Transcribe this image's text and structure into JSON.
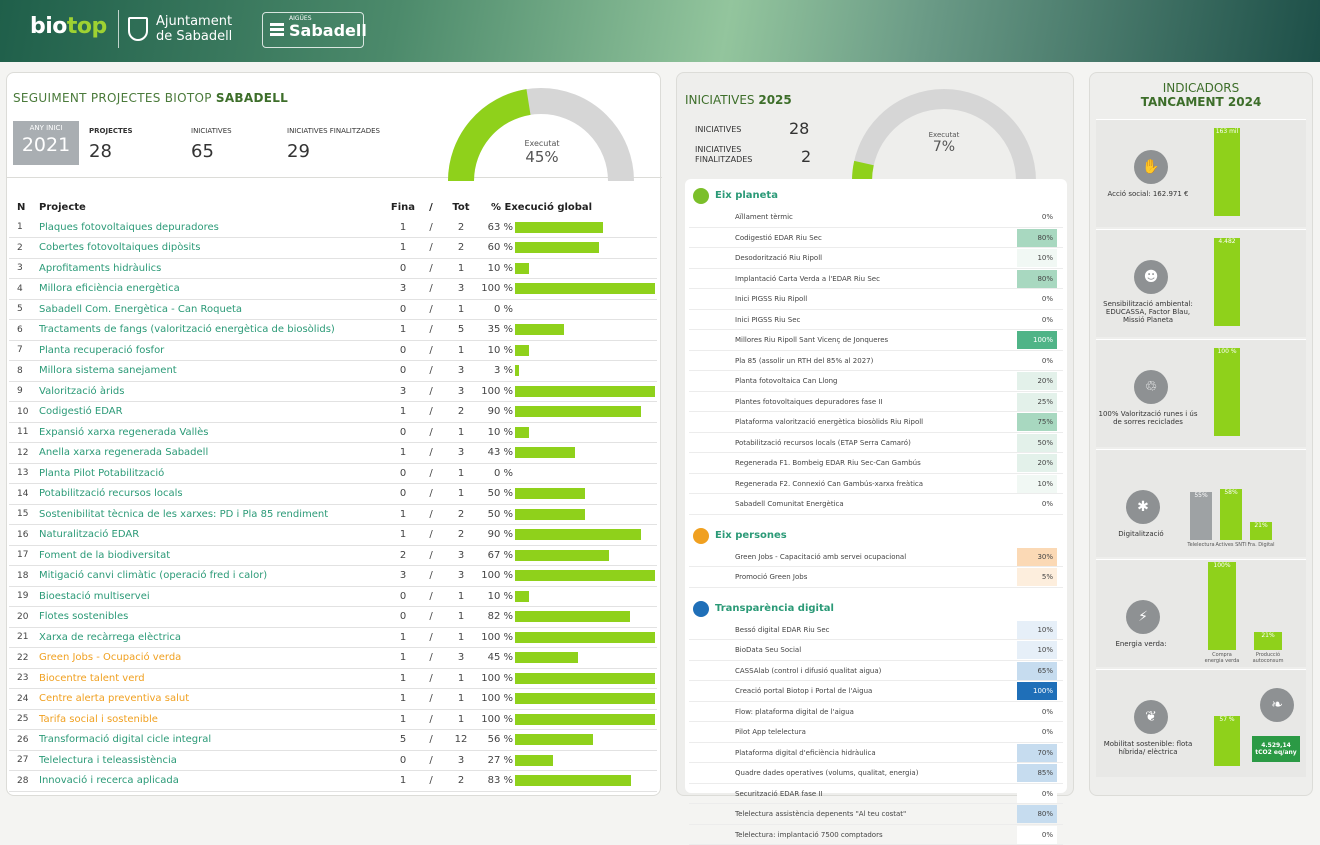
{
  "header": {
    "brand_main": "bio",
    "brand_accent": "top",
    "city_line1": "Ajuntament",
    "city_line2": "de Sabadell",
    "water_small": "AIGÜES",
    "water_name": "Sabadell"
  },
  "summary": {
    "title_prefix": "SEGUIMENT PROJECTES BIOTOP ",
    "title_bold": "SABADELL",
    "year_label": "ANY INICI",
    "year": "2021",
    "projects_label": "PROJECTES",
    "projects": "28",
    "initiatives_label": "INICIATIVES",
    "initiatives": "65",
    "finished_label": "INICIATIVES FINALITZADES",
    "finished": "29",
    "executed_label": "Executat",
    "executed": "45%",
    "executed_fraction": 0.45
  },
  "table": {
    "headers": [
      "N",
      "Projecte",
      "Fina",
      "/",
      "Tot",
      "% Execució global"
    ],
    "rows": [
      {
        "n": "1",
        "name": "Plaques fotovoltaiques depuradores",
        "fin": "1",
        "tot": "2",
        "pct": "63 %",
        "v": 63
      },
      {
        "n": "2",
        "name": "Cobertes fotovoltaiques dipòsits",
        "fin": "1",
        "tot": "2",
        "pct": "60 %",
        "v": 60
      },
      {
        "n": "3",
        "name": "Aprofitaments hidràulics",
        "fin": "0",
        "tot": "1",
        "pct": "10 %",
        "v": 10
      },
      {
        "n": "4",
        "name": "Millora eficiència energètica",
        "fin": "3",
        "tot": "3",
        "pct": "100 %",
        "v": 100
      },
      {
        "n": "5",
        "name": "Sabadell Com. Energètica - Can Roqueta",
        "fin": "0",
        "tot": "1",
        "pct": "0 %",
        "v": 0
      },
      {
        "n": "6",
        "name": "Tractaments de fangs (valorització energètica de biosòlids)",
        "fin": "1",
        "tot": "5",
        "pct": "35 %",
        "v": 35
      },
      {
        "n": "7",
        "name": "Planta recuperació fosfor",
        "fin": "0",
        "tot": "1",
        "pct": "10 %",
        "v": 10
      },
      {
        "n": "8",
        "name": "Millora sistema sanejament",
        "fin": "0",
        "tot": "3",
        "pct": "3 %",
        "v": 3
      },
      {
        "n": "9",
        "name": "Valorització àrids",
        "fin": "3",
        "tot": "3",
        "pct": "100 %",
        "v": 100
      },
      {
        "n": "10",
        "name": "Codigestió EDAR",
        "fin": "1",
        "tot": "2",
        "pct": "90 %",
        "v": 90
      },
      {
        "n": "11",
        "name": "Expansió xarxa regenerada Vallès",
        "fin": "0",
        "tot": "1",
        "pct": "10 %",
        "v": 10
      },
      {
        "n": "12",
        "name": "Anella xarxa regenerada Sabadell",
        "fin": "1",
        "tot": "3",
        "pct": "43 %",
        "v": 43
      },
      {
        "n": "13",
        "name": "Planta Pilot Potabilització",
        "fin": "0",
        "tot": "1",
        "pct": "0 %",
        "v": 0
      },
      {
        "n": "14",
        "name": "Potabilització recursos locals",
        "fin": "0",
        "tot": "1",
        "pct": "50 %",
        "v": 50
      },
      {
        "n": "15",
        "name": "Sostenibilitat tècnica de les xarxes: PD i Pla 85 rendiment",
        "fin": "1",
        "tot": "2",
        "pct": "50 %",
        "v": 50
      },
      {
        "n": "16",
        "name": "Naturalització EDAR",
        "fin": "1",
        "tot": "2",
        "pct": "90 %",
        "v": 90
      },
      {
        "n": "17",
        "name": "Foment de la biodiversitat",
        "fin": "2",
        "tot": "3",
        "pct": "67 %",
        "v": 67
      },
      {
        "n": "18",
        "name": "Mitigació canvi climàtic (operació fred i calor)",
        "fin": "3",
        "tot": "3",
        "pct": "100 %",
        "v": 100
      },
      {
        "n": "19",
        "name": "Bioestació multiservei",
        "fin": "0",
        "tot": "1",
        "pct": "10 %",
        "v": 10
      },
      {
        "n": "20",
        "name": "Flotes sostenibles",
        "fin": "0",
        "tot": "1",
        "pct": "82 %",
        "v": 82
      },
      {
        "n": "21",
        "name": "Xarxa de recàrrega elèctrica",
        "fin": "1",
        "tot": "1",
        "pct": "100 %",
        "v": 100
      },
      {
        "n": "22",
        "name": "Green Jobs - Ocupació verda",
        "fin": "1",
        "tot": "3",
        "pct": "45 %",
        "v": 45,
        "orange": true
      },
      {
        "n": "23",
        "name": "Biocentre talent verd",
        "fin": "1",
        "tot": "1",
        "pct": "100 %",
        "v": 100,
        "orange": true
      },
      {
        "n": "24",
        "name": "Centre alerta preventiva salut",
        "fin": "1",
        "tot": "1",
        "pct": "100 %",
        "v": 100,
        "orange": true
      },
      {
        "n": "25",
        "name": "Tarifa social i sostenible",
        "fin": "1",
        "tot": "1",
        "pct": "100 %",
        "v": 100,
        "orange": true
      },
      {
        "n": "26",
        "name": "Transformació digital cicle integral",
        "fin": "5",
        "tot": "12",
        "pct": "56 %",
        "v": 56
      },
      {
        "n": "27",
        "name": "Telelectura i teleassistència",
        "fin": "0",
        "tot": "3",
        "pct": "27 %",
        "v": 27
      },
      {
        "n": "28",
        "name": "Innovació i recerca aplicada",
        "fin": "1",
        "tot": "2",
        "pct": "83 %",
        "v": 83
      }
    ]
  },
  "initiatives": {
    "title_prefix": "INICIATIVES ",
    "title_year": "2025",
    "total_label": "INICIATIVES",
    "total": "28",
    "finished_label_1": "INICIATIVES",
    "finished_label_2": "FINALITZADES",
    "finished": "2",
    "executed_label": "Executat",
    "executed": "7%",
    "executed_fraction": 0.07,
    "sections": [
      {
        "title": "Eix planeta",
        "icon": "planet-icon",
        "color": "#7bbf2a",
        "rows": [
          {
            "label": "Aïllament tèrmic",
            "val": "0%"
          },
          {
            "label": "Codigestió EDAR Riu Sec",
            "val": "80%"
          },
          {
            "label": "Desodorització Riu Ripoll",
            "val": "10%"
          },
          {
            "label": "Implantació Carta Verda a l'EDAR Riu Sec",
            "val": "80%"
          },
          {
            "label": "Inici PIGSS Riu Ripoll",
            "val": "0%"
          },
          {
            "label": "Inici PIGSS Riu Sec",
            "val": "0%"
          },
          {
            "label": "Millores Riu Ripoll Sant Vicenç de Jonqueres",
            "val": "100%"
          },
          {
            "label": "Pla 85 (assolir un RTH del 85% al 2027)",
            "val": "0%"
          },
          {
            "label": "Planta fotovoltaica Can Llong",
            "val": "20%"
          },
          {
            "label": "Plantes fotovoltaiques depuradores fase II",
            "val": "25%"
          },
          {
            "label": "Plataforma valorització energètica biosòlids Riu Ripoll",
            "val": "75%"
          },
          {
            "label": "Potabilització recursos locals (ETAP Serra Camaró)",
            "val": "50%"
          },
          {
            "label": "Regenerada F1. Bombeig EDAR Riu Sec-Can Gambús",
            "val": "20%"
          },
          {
            "label": "Regenerada F2. Connexió Can Gambús-xarxa freàtica",
            "val": "10%"
          },
          {
            "label": "Sabadell Comunitat Energètica",
            "val": "0%"
          }
        ]
      },
      {
        "title": "Eix persones",
        "icon": "people-icon",
        "color": "#f0a020",
        "rows": [
          {
            "label": "Green Jobs - Capacitació amb servei ocupacional",
            "val": "30%"
          },
          {
            "label": "Promoció Green Jobs",
            "val": "5%"
          }
        ]
      },
      {
        "title": "Transparència digital",
        "icon": "ring-icon",
        "color": "#1f6fb8",
        "rows": [
          {
            "label": "Bessó digital EDAR Riu Sec",
            "val": "10%"
          },
          {
            "label": "BioData Seu Social",
            "val": "10%"
          },
          {
            "label": "CASSAlab (control i difusió qualitat aigua)",
            "val": "65%"
          },
          {
            "label": "Creació portal Biotop i Portal de l'Aigua",
            "val": "100%"
          },
          {
            "label": "Flow: plataforma digital de l'aigua",
            "val": "0%"
          },
          {
            "label": "Pilot App telelectura",
            "val": "0%"
          },
          {
            "label": "Plataforma digital d'eficiència hidràulica",
            "val": "70%"
          },
          {
            "label": "Quadre dades operatives (volums, qualitat, energia)",
            "val": "85%"
          },
          {
            "label": "Securització EDAR fase II",
            "val": "0%"
          },
          {
            "label": "Telelectura assistència depenents \"Al teu costat\"",
            "val": "80%"
          },
          {
            "label": "Telelectura: implantació 7500 comptadors",
            "val": "0%"
          }
        ]
      }
    ]
  },
  "indicators": {
    "title_1": "INDICADORS",
    "title_2": "TANCAMENT 2024",
    "cards": [
      {
        "icon": "handshake-icon",
        "label": "Acció social: 162.971 €",
        "bar_label": "163 mil",
        "fill": 1
      },
      {
        "icon": "community-icon",
        "label": "Sensibilització ambiental: EDUCASSA, Factor Blau, Missió Planeta",
        "bar_label": "4.482",
        "fill": 1
      },
      {
        "icon": "recycle-bin-icon",
        "label": "100% Valorització runes i ús de sorres reciclades",
        "bar_label": "100 %",
        "fill": 1
      },
      {
        "icon": "network-icon",
        "label": "Digitalització",
        "bars": [
          {
            "label": "55%",
            "sub": "Telelectura",
            "v": 0.55,
            "gray": true
          },
          {
            "label": "58%",
            "sub": "Actives SNTI",
            "v": 0.58
          },
          {
            "label": "21%",
            "sub": "Fra. Digital",
            "v": 0.21
          }
        ]
      },
      {
        "icon": "lightning-icon",
        "label": "Energia verda:",
        "bars": [
          {
            "label": "100%",
            "sub": "Compra energia verda",
            "v": 1
          },
          {
            "label": "21%",
            "sub": "Producció autoconsum",
            "v": 0.21
          }
        ]
      },
      {
        "icon": "plant-icon",
        "label": "Mobilitat sostenible: flota híbrida/ elèctrica",
        "bar_label": "57 %",
        "fill": 0.57,
        "extra_icon": "leaf-icon",
        "extra_label": "4.529,14 tCO2 eq/any"
      }
    ]
  }
}
